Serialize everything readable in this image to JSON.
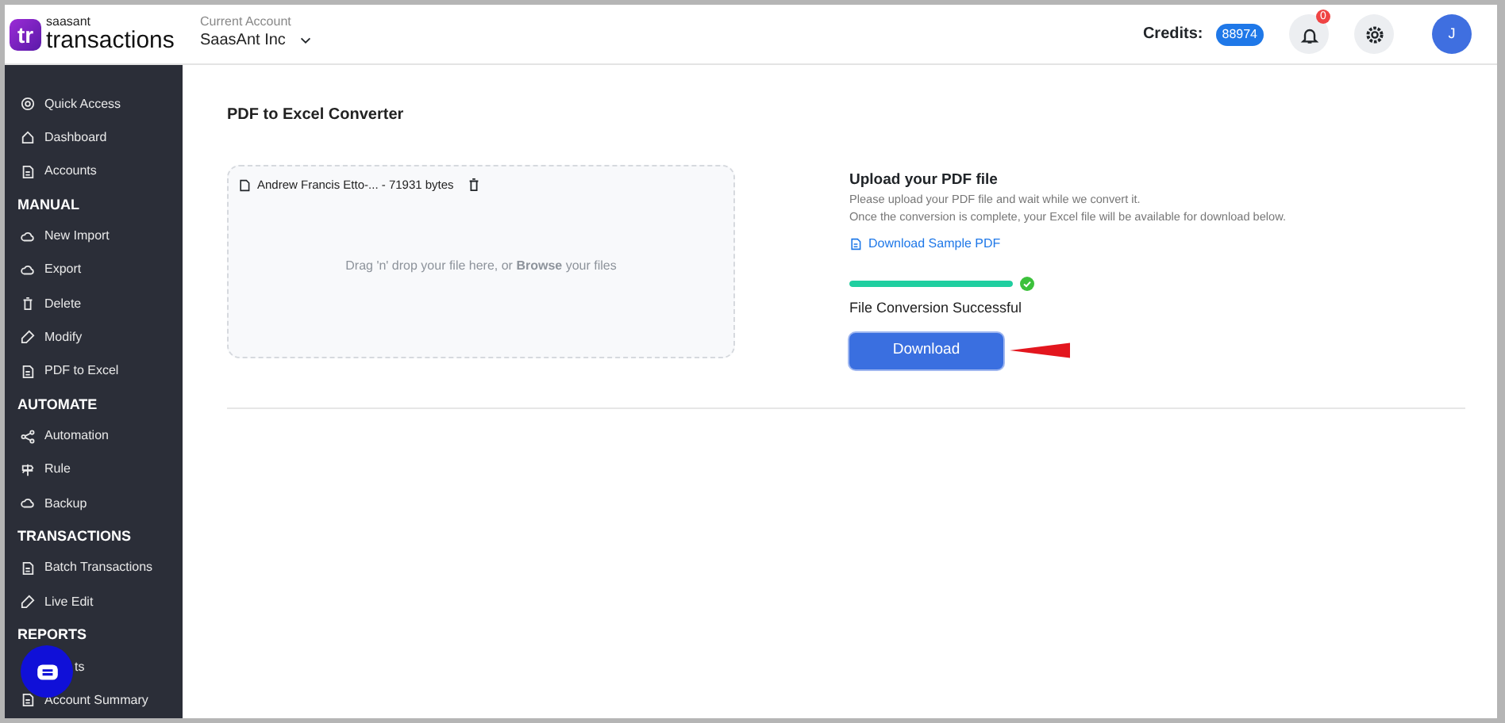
{
  "header": {
    "logo": "tr",
    "brand_top": "saasant",
    "brand": "transactions",
    "account_label": "Current Account",
    "account": "SaasAnt Inc",
    "credits_label": "Credits:",
    "credits": "88974",
    "notifications": "0",
    "avatar": "J"
  },
  "sidebar": {
    "sections": [
      {
        "items": [
          {
            "label": "Quick Access"
          },
          {
            "label": "Dashboard"
          },
          {
            "label": "Accounts"
          }
        ]
      },
      {
        "title": "MANUAL",
        "items": [
          {
            "label": "New Import"
          },
          {
            "label": "Export"
          },
          {
            "label": "Delete"
          },
          {
            "label": "Modify"
          },
          {
            "label": "PDF to Excel"
          }
        ]
      },
      {
        "title": "AUTOMATE",
        "items": [
          {
            "label": "Automation"
          },
          {
            "label": "Rule"
          },
          {
            "label": "Backup"
          }
        ]
      },
      {
        "title": "TRANSACTIONS",
        "items": [
          {
            "label": "Batch Transactions"
          },
          {
            "label": "Live Edit"
          }
        ]
      },
      {
        "title": "REPORTS",
        "items": [
          {
            "label": "ts",
            "kind": "covered"
          },
          {
            "label": "Account Summary",
            "kind": "plain"
          }
        ]
      }
    ]
  },
  "main": {
    "title": "PDF to Excel Converter",
    "dropzone": {
      "file": "Andrew Francis Etto-... - 71931 bytes",
      "hint_before": "Drag 'n' drop your file here, or",
      "browse": "Browse",
      "hint_after": "your files"
    },
    "upload": {
      "title": "Upload your PDF file",
      "line_1": "Please upload your PDF file and wait while we convert it.",
      "line_2": "Once the conversion is complete, your Excel file will be available for download below.",
      "sample_link": "Download Sample PDF",
      "level": 1,
      "status": "File Conversion Successful",
      "button": "Download"
    }
  }
}
